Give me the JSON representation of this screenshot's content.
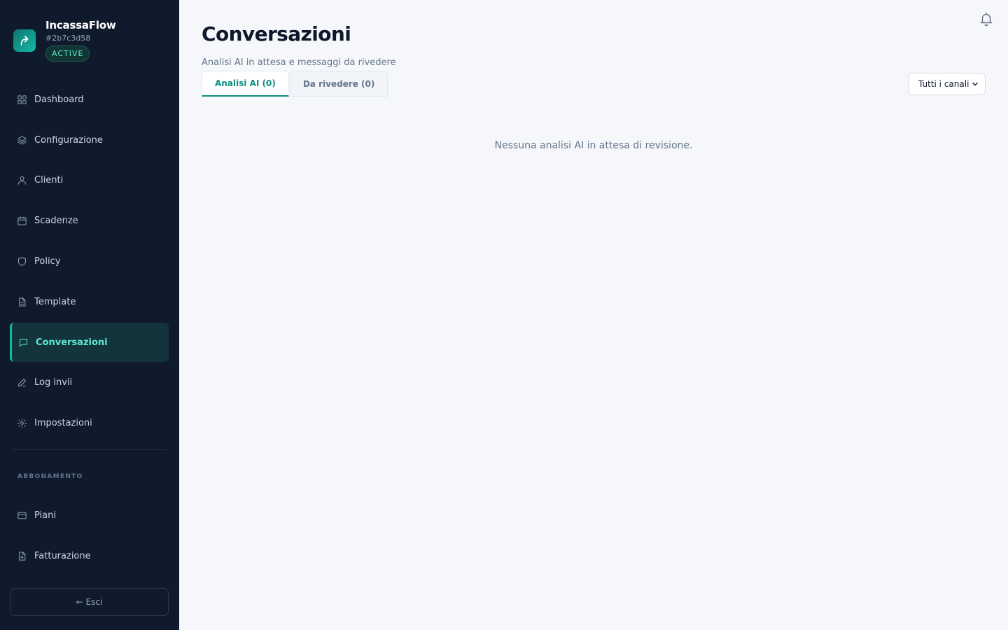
{
  "brand": {
    "name": "IncassaFlow",
    "id": "#2b7c3d58",
    "status": "ACTIVE"
  },
  "sidebar": {
    "items": [
      {
        "label": "Dashboard",
        "icon": "grid-icon"
      },
      {
        "label": "Configurazione",
        "icon": "layers-icon"
      },
      {
        "label": "Clienti",
        "icon": "user-icon"
      },
      {
        "label": "Scadenze",
        "icon": "calendar-icon"
      },
      {
        "label": "Policy",
        "icon": "shield-icon"
      },
      {
        "label": "Template",
        "icon": "document-icon"
      },
      {
        "label": "Conversazioni",
        "icon": "chat-icon",
        "active": true
      },
      {
        "label": "Log invii",
        "icon": "pencil-icon"
      },
      {
        "label": "Impostazioni",
        "icon": "gear-icon"
      }
    ],
    "section_label": "ABBONAMENTO",
    "billing_items": [
      {
        "label": "Piani",
        "icon": "card-icon"
      },
      {
        "label": "Fatturazione",
        "icon": "invoice-icon"
      }
    ],
    "logout_label": "← Esci"
  },
  "main": {
    "title": "Conversazioni",
    "subtitle": "Analisi AI in attesa e messaggi da rivedere",
    "tabs": [
      {
        "label": "Analisi AI (0)",
        "active": true
      },
      {
        "label": "Da rivedere (0)",
        "active": false
      }
    ],
    "channel_filter": {
      "selected": "Tutti i canali"
    },
    "empty_message": "Nessuna analisi AI in attesa di revisione."
  },
  "colors": {
    "sidebar_bg": "#0f1b2d",
    "accent": "#14b8a6",
    "active_tab": "#0f8f83",
    "page_bg": "#f5f7fa"
  }
}
